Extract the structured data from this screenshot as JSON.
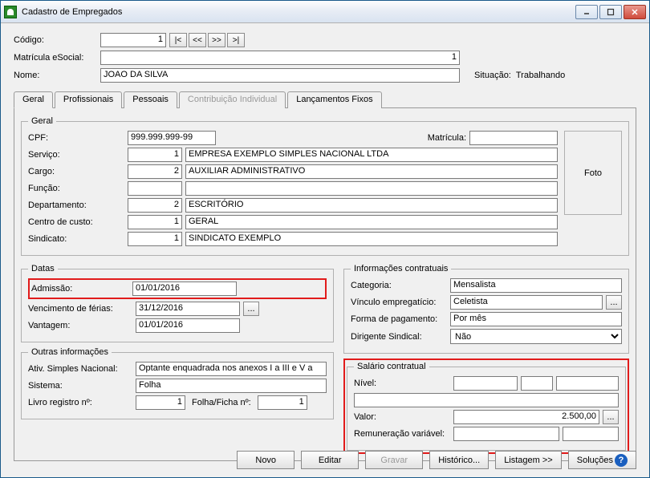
{
  "window": {
    "title": "Cadastro de Empregados"
  },
  "header": {
    "codigo_label": "Código:",
    "codigo_value": "1",
    "nav": {
      "first": "|<",
      "prev": "<<",
      "next": ">>",
      "last": ">|"
    },
    "matricula_esocial_label": "Matrícula eSocial:",
    "matricula_esocial_value": "1",
    "nome_label": "Nome:",
    "nome_value": "JOAO DA SILVA",
    "situacao_label": "Situação:",
    "situacao_value": "Trabalhando"
  },
  "tabs": {
    "geral": "Geral",
    "profissionais": "Profissionais",
    "pessoais": "Pessoais",
    "contrib": "Contribuição Individual",
    "lancamentos": "Lançamentos Fixos"
  },
  "geral_group": {
    "legend": "Geral",
    "cpf_label": "CPF:",
    "cpf_value": "999.999.999-99",
    "matricula_label": "Matrícula:",
    "matricula_value": "",
    "servico_label": "Serviço:",
    "servico_cod": "1",
    "servico_nome": "EMPRESA EXEMPLO SIMPLES NACIONAL LTDA",
    "cargo_label": "Cargo:",
    "cargo_cod": "2",
    "cargo_nome": "AUXILIAR ADMINISTRATIVO",
    "funcao_label": "Função:",
    "funcao_cod": "",
    "funcao_nome": "",
    "depto_label": "Departamento:",
    "depto_cod": "2",
    "depto_nome": "ESCRITÓRIO",
    "cc_label": "Centro de custo:",
    "cc_cod": "1",
    "cc_nome": "GERAL",
    "sind_label": "Sindicato:",
    "sind_cod": "1",
    "sind_nome": "SINDICATO EXEMPLO",
    "foto": "Foto"
  },
  "datas": {
    "legend": "Datas",
    "admissao_label": "Admissão:",
    "admissao_value": "01/01/2016",
    "venc_ferias_label": "Vencimento de férias:",
    "venc_ferias_value": "31/12/2016",
    "vantagem_label": "Vantagem:",
    "vantagem_value": "01/01/2016"
  },
  "contratuais": {
    "legend": "Informações contratuais",
    "categoria_label": "Categoria:",
    "categoria_value": "Mensalista",
    "vinculo_label": "Vínculo empregatício:",
    "vinculo_value": "Celetista",
    "forma_label": "Forma de pagamento:",
    "forma_value": "Por mês",
    "dirigente_label": "Dirigente Sindical:",
    "dirigente_value": "Não"
  },
  "outras": {
    "legend": "Outras informações",
    "simples_label": "Ativ. Simples Nacional:",
    "simples_value": "Optante enquadrada nos anexos I a III e V a",
    "sistema_label": "Sistema:",
    "sistema_value": "Folha",
    "livro_label": "Livro registro nº:",
    "livro_value": "1",
    "folha_label": "Folha/Ficha nº:",
    "folha_value": "1"
  },
  "salario": {
    "legend": "Salário contratual",
    "nivel_label": "Nível:",
    "nivel_v1": "",
    "nivel_v2": "",
    "nivel_v3": "",
    "nivel_desc": "",
    "valor_label": "Valor:",
    "valor_value": "2.500,00",
    "remun_label": "Remuneração variável:",
    "remun_v1": "",
    "remun_v2": ""
  },
  "footer": {
    "novo": "Novo",
    "editar": "Editar",
    "gravar": "Gravar",
    "historico": "Histórico...",
    "listagem": "Listagem >>",
    "solucoes": "Soluções"
  },
  "ellipsis": "..."
}
